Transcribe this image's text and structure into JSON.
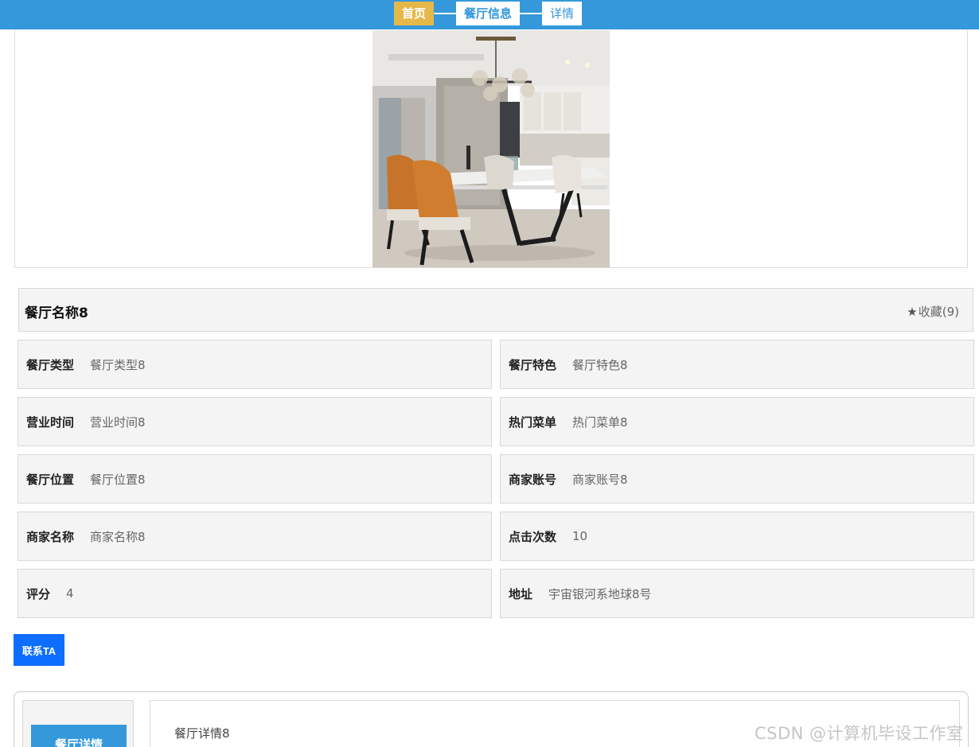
{
  "breadcrumb": {
    "home": "首页",
    "section": "餐厅信息",
    "current": "详情"
  },
  "restaurant": {
    "name": "餐厅名称8",
    "favorite_label": "收藏(9)",
    "favorite_icon": "star-icon"
  },
  "info": {
    "type": {
      "label": "餐厅类型",
      "value": "餐厅类型8"
    },
    "feature": {
      "label": "餐厅特色",
      "value": "餐厅特色8"
    },
    "hours": {
      "label": "营业时间",
      "value": "营业时间8"
    },
    "menu": {
      "label": "热门菜单",
      "value": "热门菜单8"
    },
    "location": {
      "label": "餐厅位置",
      "value": "餐厅位置8"
    },
    "account": {
      "label": "商家账号",
      "value": "商家账号8"
    },
    "merchant": {
      "label": "商家名称",
      "value": "商家名称8"
    },
    "clicks": {
      "label": "点击次数",
      "value": "10"
    },
    "rating": {
      "label": "评分",
      "value": "4"
    },
    "address": {
      "label": "地址",
      "value": "宇宙银河系地球8号"
    }
  },
  "contact_button": "联系TA",
  "detail": {
    "tab_label": "餐厅详情",
    "content": "餐厅详情8"
  },
  "watermark": "CSDN @计算机毕设工作室",
  "colors": {
    "topbar": "#3498db",
    "home_crumb": "#e6b84a",
    "contact_button": "#0d6efd",
    "tab_button": "#3498db",
    "cell_bg": "#f4f4f4"
  }
}
